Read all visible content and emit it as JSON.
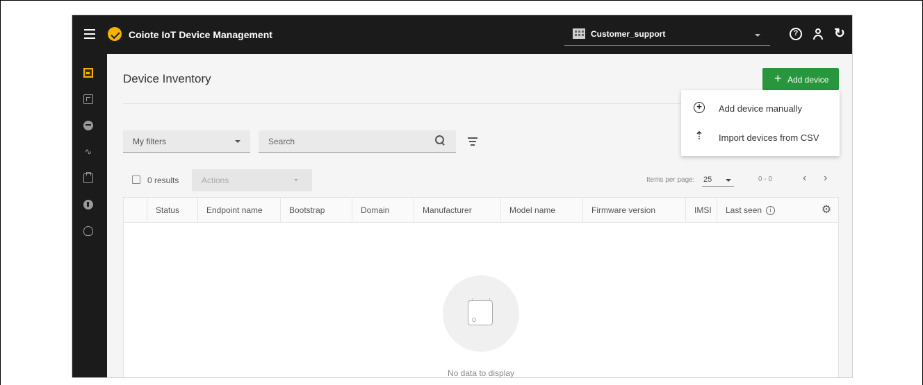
{
  "app": {
    "title": "Coiote IoT Device Management",
    "workspace": "Customer_support"
  },
  "icons": {
    "help": "?",
    "refresh": "↻",
    "settings": "⚙",
    "info": "i",
    "prev": "‹",
    "next": "›"
  },
  "page": {
    "title": "Device Inventory",
    "add_button": "Add device",
    "add_plus": "+"
  },
  "menu": {
    "items": [
      {
        "label": "Add device manually",
        "icon": "add-circle-icon"
      },
      {
        "label": "Import devices from CSV",
        "icon": "upload-icon"
      }
    ]
  },
  "filters": {
    "my_filters": "My filters",
    "search_placeholder": "Search"
  },
  "results": {
    "count_label": "0 results",
    "actions": "Actions",
    "items_per_page_label": "Items per page:",
    "items_per_page": "25",
    "range": "0 - 0"
  },
  "table": {
    "columns": [
      "Status",
      "Endpoint name",
      "Bootstrap",
      "Domain",
      "Manufacturer",
      "Model name",
      "Firmware version",
      "IMSI",
      "Last seen"
    ],
    "empty_message": "No data to display"
  },
  "colors": {
    "topbar": "#1b1b1b",
    "accent": "#f4b400",
    "primary_button": "#27963c"
  }
}
